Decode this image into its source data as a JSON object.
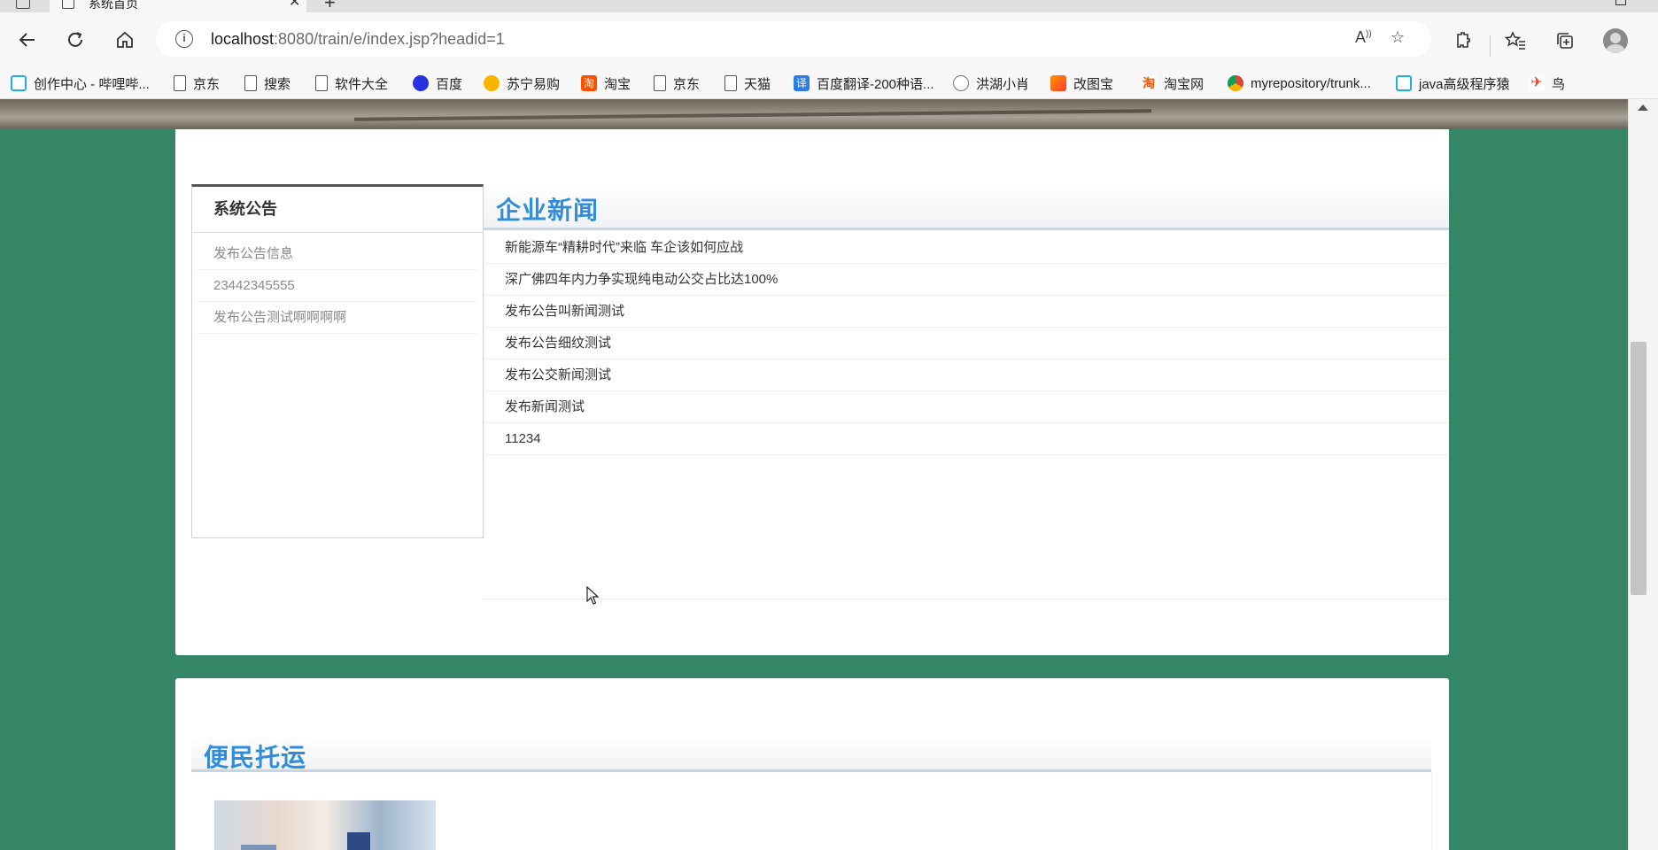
{
  "browser": {
    "tab_title": "系统首页",
    "address": {
      "host": "localhost",
      "path": ":8080/train/e/index.jsp?headid=1"
    }
  },
  "bookmarks": [
    {
      "label": "创作中心 - 哔哩哔...",
      "icon": "bilibili-icon"
    },
    {
      "label": "京东",
      "icon": "page-icon"
    },
    {
      "label": "搜索",
      "icon": "page-icon"
    },
    {
      "label": "软件大全",
      "icon": "page-icon"
    },
    {
      "label": "百度",
      "icon": "baidu-icon"
    },
    {
      "label": "苏宁易购",
      "icon": "suning-icon"
    },
    {
      "label": "淘宝",
      "icon": "taobao-icon"
    },
    {
      "label": "京东",
      "icon": "page-icon"
    },
    {
      "label": "天猫",
      "icon": "page-icon"
    },
    {
      "label": "百度翻译-200种语...",
      "icon": "translate-icon"
    },
    {
      "label": "洪湖小肖",
      "icon": "honghu-icon"
    },
    {
      "label": "改图宝",
      "icon": "gaitubao-icon"
    },
    {
      "label": "淘宝网",
      "icon": "taobao-icon"
    },
    {
      "label": "myrepository/trunk...",
      "icon": "chrome-icon"
    },
    {
      "label": "java高级程序猿",
      "icon": "bilibili-icon"
    },
    {
      "label": "鸟",
      "icon": "bird-icon"
    }
  ],
  "notice": {
    "title": "系统公告",
    "items": [
      "发布公告信息",
      "23442345555",
      "发布公告测试啊啊啊啊"
    ]
  },
  "news": {
    "title": "企业新闻",
    "items": [
      "新能源车“精耕时代”来临 车企该如何应战",
      "深广佛四年内力争实现纯电动公交占比达100%",
      "发布公告叫新闻测试",
      "发布公告细纹测试",
      "发布公交新闻测试",
      "发布新闻测试",
      "11234"
    ]
  },
  "shipping": {
    "title": "便民托运"
  },
  "colors": {
    "page_background": "#348666",
    "heading_blue": "#2f8ddc"
  }
}
